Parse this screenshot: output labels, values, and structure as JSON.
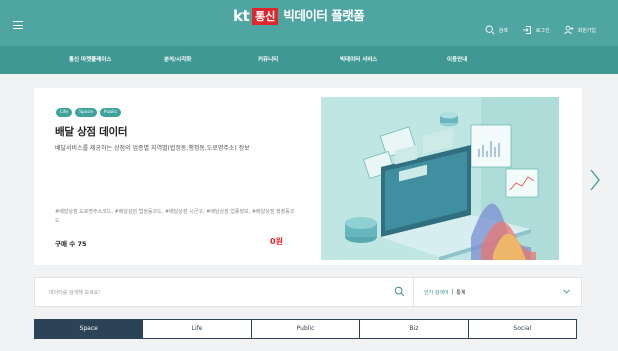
{
  "header": {
    "logo_kt": "kt",
    "logo_badge": "통신",
    "logo_title": "빅데이터 플랫폼",
    "actions": [
      {
        "label": "검색",
        "icon": "search-icon"
      },
      {
        "label": "로그인",
        "icon": "login-icon"
      },
      {
        "label": "회원가입",
        "icon": "user-add-icon"
      }
    ]
  },
  "nav": {
    "items": [
      "통신 마켓플레이스",
      "분석/시각화",
      "커뮤니티",
      "빅데이터 서비스",
      "이용안내"
    ]
  },
  "hero": {
    "chips": [
      "Life",
      "Space",
      "Public"
    ],
    "title": "배달 상점 데이터",
    "description": "배달서비스를 제공하는 상점의 업종별 지역별(법정동,행정동,도로명주소) 정보",
    "tags": "#배달상점 도로명주소코드, #배달상점 법정동코드, #배달상점 시군구, #배달상점 업종정보, #배달상점 행정동코드",
    "buy_count": "구매 수 75",
    "price": "0원"
  },
  "search": {
    "placeholder": "데이터를 검색해 보세요!",
    "popular_label": "인기 검색어",
    "popular_sep": "|",
    "popular_value": "통계"
  },
  "tabs": {
    "items": [
      "Space",
      "Life",
      "Public",
      "Biz",
      "Social"
    ],
    "active": "Space"
  },
  "colors": {
    "header_bg": "#4fa5a1",
    "nav_bg": "#3f9893",
    "accent_red": "#e0262b",
    "tab_navy": "#2c4357",
    "chip": "#3fa29d"
  }
}
